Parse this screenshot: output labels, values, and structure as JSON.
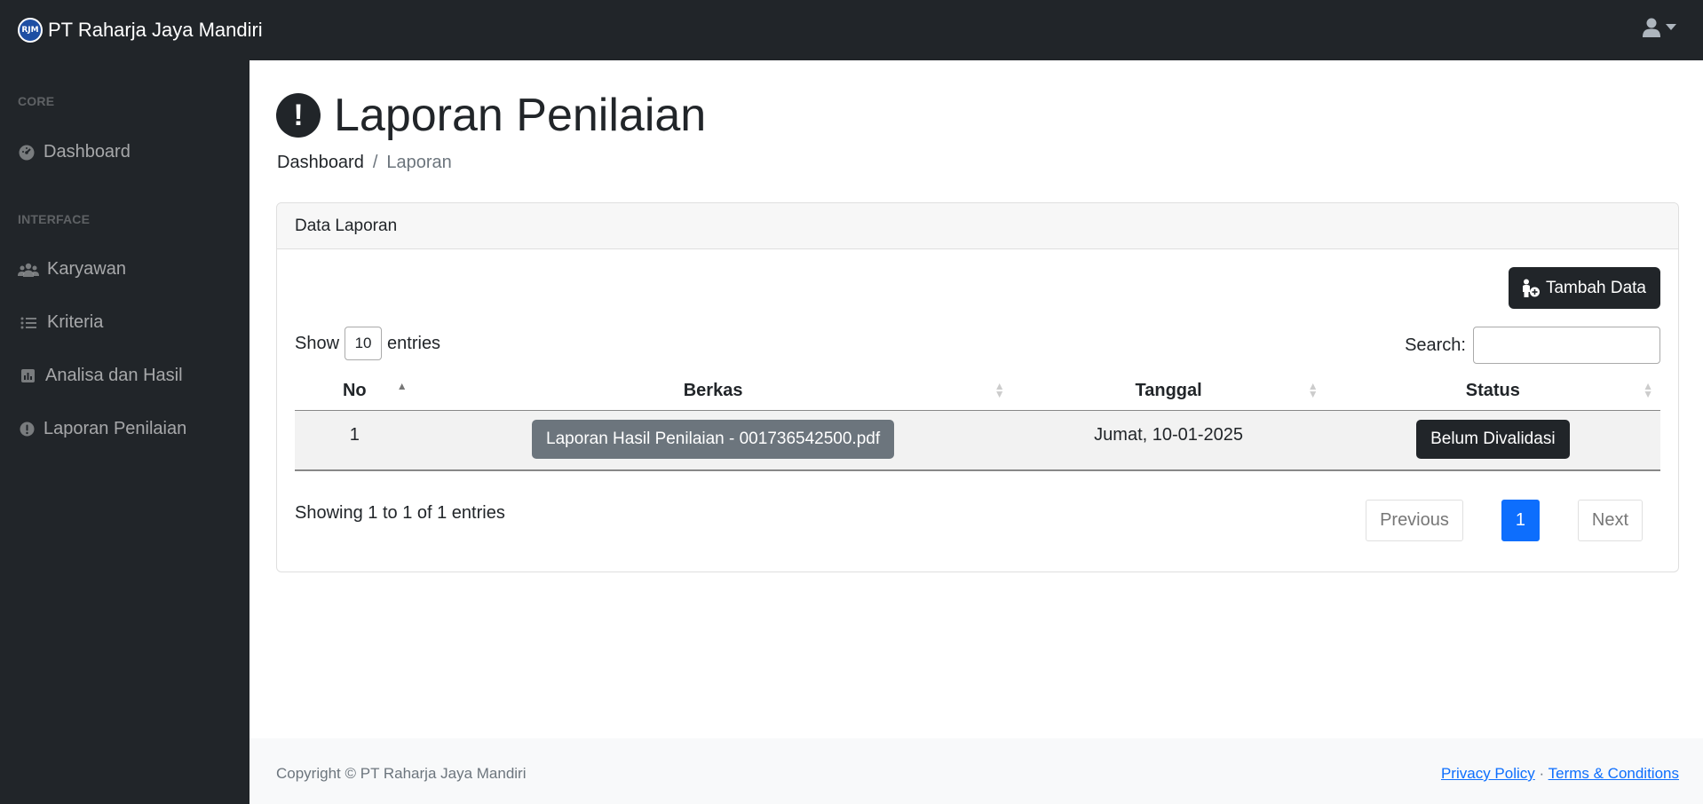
{
  "app": {
    "brand": "PT Raharja Jaya Mandiri",
    "logo_text": "RJM"
  },
  "topbar": {
    "user_icon": "user-icon",
    "caret_icon": "caret-down-icon"
  },
  "sidebar": {
    "core_heading": "Core",
    "interface_heading": "Interface",
    "items": [
      {
        "label": "Dashboard",
        "icon": "tachometer-icon"
      },
      {
        "label": "Karyawan",
        "icon": "users-icon"
      },
      {
        "label": "Kriteria",
        "icon": "list-icon"
      },
      {
        "label": "Analisa dan Hasil",
        "icon": "bar-chart-icon"
      },
      {
        "label": "Laporan Penilaian",
        "icon": "exclamation-circle-icon"
      }
    ]
  },
  "page": {
    "title": "Laporan Penilaian",
    "title_icon": "!",
    "breadcrumb": {
      "home": "Dashboard",
      "separator": "/",
      "current": "Laporan"
    }
  },
  "card": {
    "header": "Data Laporan",
    "add_button": "Tambah Data",
    "show_label": "Show",
    "entries_value": "10",
    "entries_label": "entries",
    "search_label": "Search:",
    "search_value": "",
    "table": {
      "columns": [
        "No",
        "Berkas",
        "Tanggal",
        "Status"
      ],
      "rows": [
        {
          "no": "1",
          "berkas": "Laporan Hasil Penilaian - 001736542500.pdf",
          "tanggal": "Jumat, 10-01-2025",
          "status": "Belum Divalidasi"
        }
      ]
    },
    "info": "Showing 1 to 1 of 1 entries",
    "pagination": {
      "previous": "Previous",
      "current": "1",
      "next": "Next"
    }
  },
  "footer": {
    "copyright": "Copyright © PT Raharja Jaya Mandiri",
    "privacy": "Privacy Policy",
    "separator": "·",
    "terms": "Terms & Conditions"
  },
  "colors": {
    "dark": "#212529",
    "primary": "#0d6efd",
    "secondary": "#6c757d"
  }
}
